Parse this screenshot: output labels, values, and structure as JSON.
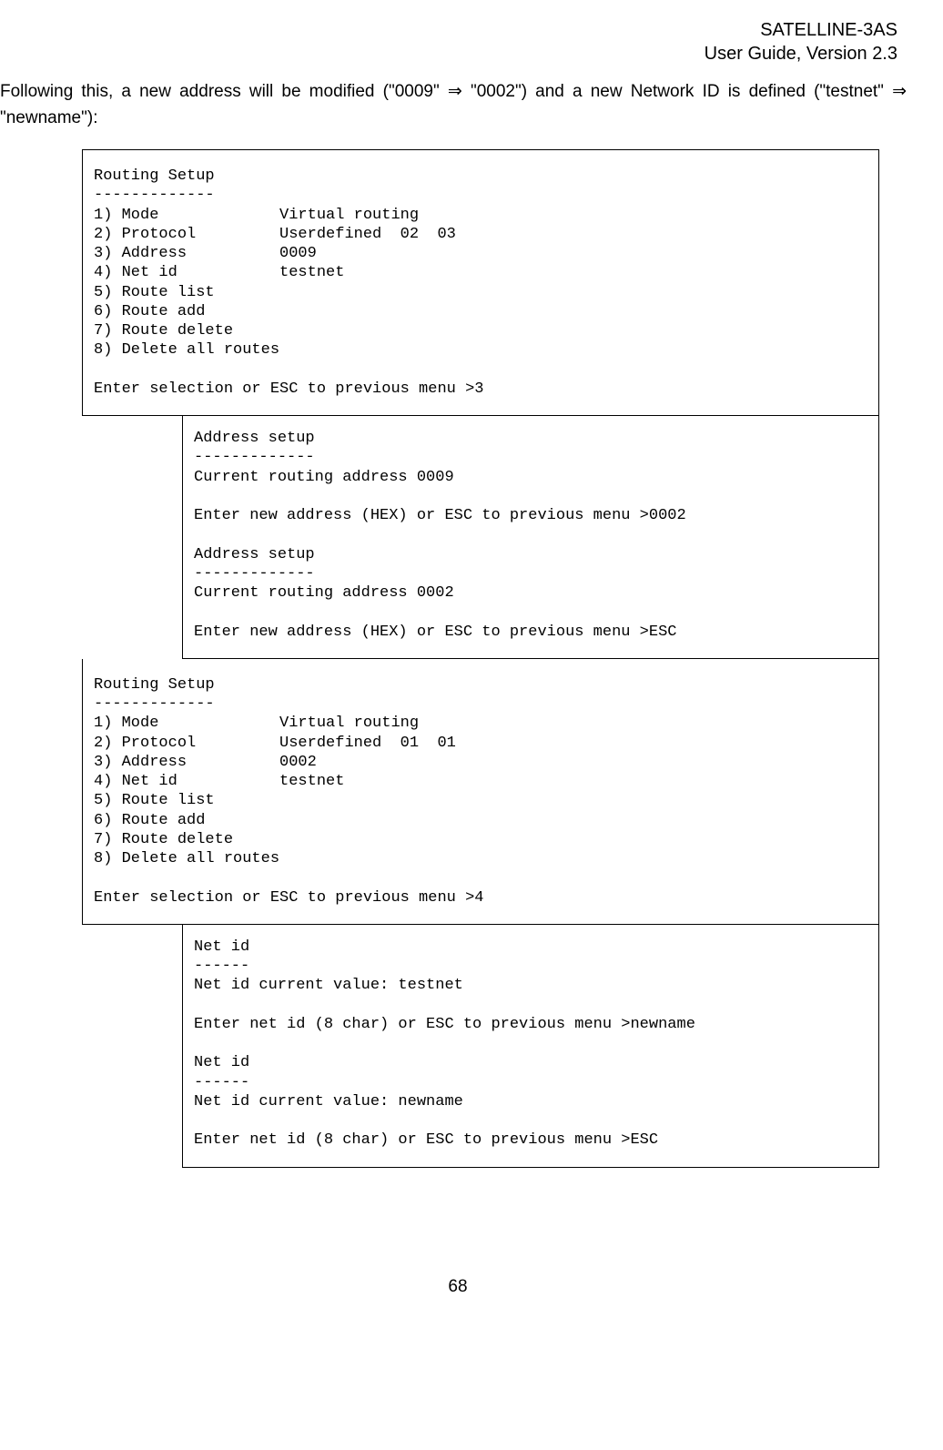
{
  "header": {
    "line1": "SATELLINE-3AS",
    "line2": "User Guide, Version 2.3"
  },
  "intro_parts": {
    "p1": "Following this, a new address will be modified (\"0009\" ",
    "arrow": "⇒",
    "p2": " \"0002\") and a new Network ID is defined (\"testnet\" ",
    "p3": " \"newname\"):"
  },
  "box1": "Routing Setup\n-------------\n1) Mode             Virtual routing\n2) Protocol         Userdefined  02  03\n3) Address          0009\n4) Net id           testnet\n5) Route list\n6) Route add\n7) Route delete\n8) Delete all routes\n\nEnter selection or ESC to previous menu >3",
  "box2": "Address setup\n-------------\nCurrent routing address 0009\n\nEnter new address (HEX) or ESC to previous menu >0002\n\nAddress setup\n-------------\nCurrent routing address 0002\n\nEnter new address (HEX) or ESC to previous menu >ESC",
  "box3": "Routing Setup\n-------------\n1) Mode             Virtual routing\n2) Protocol         Userdefined  01  01\n3) Address          0002\n4) Net id           testnet\n5) Route list\n6) Route add\n7) Route delete\n8) Delete all routes\n\nEnter selection or ESC to previous menu >4",
  "box4": "Net id\n------\nNet id current value: testnet\n\nEnter net id (8 char) or ESC to previous menu >newname\n\nNet id\n------\nNet id current value: newname\n\nEnter net id (8 char) or ESC to previous menu >ESC",
  "page_number": "68"
}
